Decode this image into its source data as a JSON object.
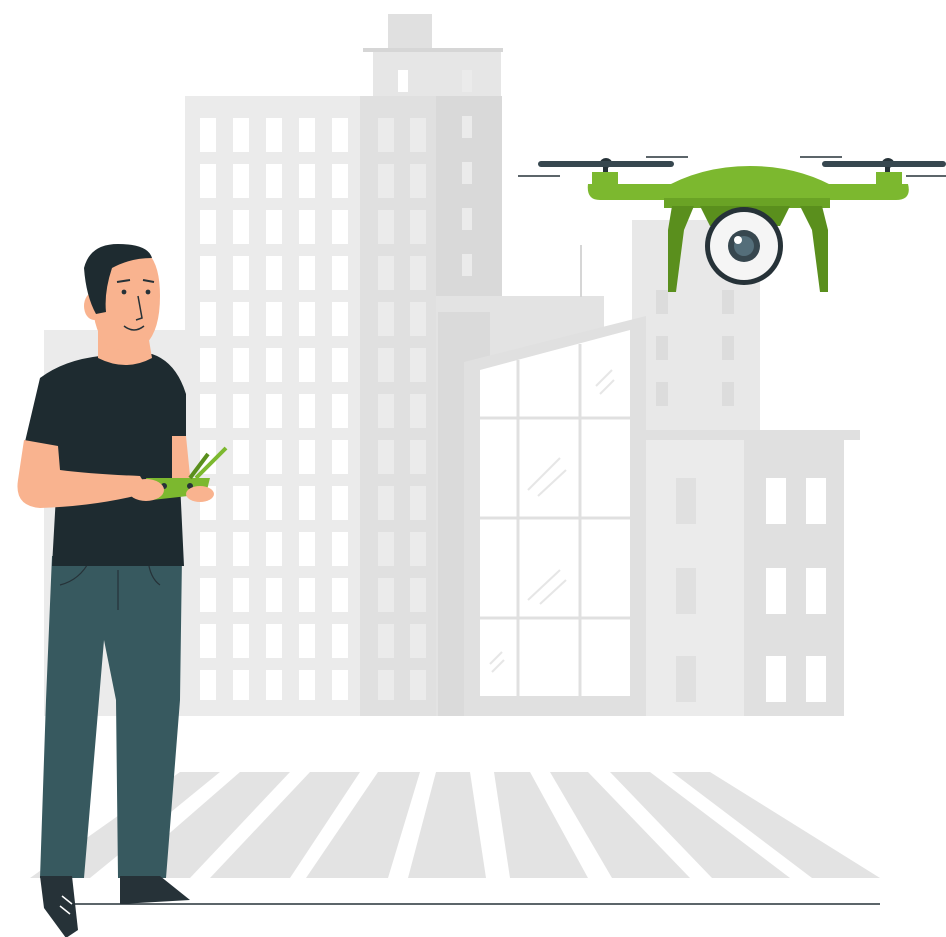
{
  "illustration": {
    "subjects": [
      "man-with-remote-controller",
      "camera-drone",
      "city-buildings",
      "crosswalk"
    ],
    "colors": {
      "background": "#ffffff",
      "building_light": "#ebebeb",
      "building_mid": "#e0e0e0",
      "building_dark": "#d6d6d6",
      "window": "#ffffff",
      "drone_green": "#7cb82f",
      "drone_green_dark": "#5a8f1d",
      "drone_dark": "#263238",
      "shirt": "#1e2b30",
      "pants": "#37595f",
      "skin": "#f9b38f",
      "hair": "#1e2b30",
      "shoe": "#263238",
      "ground_line": "#263238"
    }
  }
}
